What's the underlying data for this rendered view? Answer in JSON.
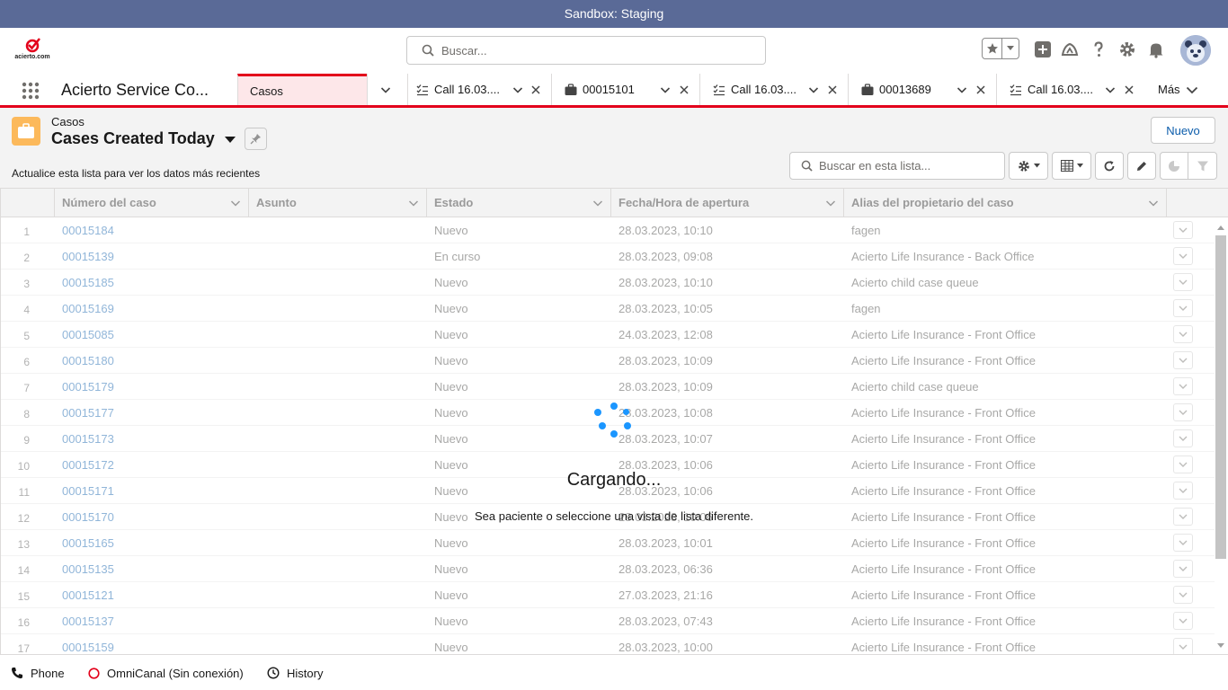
{
  "sandbox_banner": "Sandbox: Staging",
  "header": {
    "logo_text": "acierto.com",
    "search_placeholder": "Buscar..."
  },
  "nav": {
    "app_name": "Acierto Service Co...",
    "tabs": [
      {
        "label": "Casos",
        "icon": "none",
        "active": true
      },
      {
        "label": "Call 16.03....",
        "icon": "task-list-icon"
      },
      {
        "label": "00015101",
        "icon": "case-briefcase-icon"
      },
      {
        "label": "Call 16.03....",
        "icon": "task-list-icon"
      },
      {
        "label": "00013689",
        "icon": "case-briefcase-icon"
      },
      {
        "label": "Call 16.03....",
        "icon": "task-list-icon"
      }
    ],
    "more_label": "Más"
  },
  "list_view": {
    "object_label": "Casos",
    "view_name": "Cases Created Today",
    "info_text": "Actualice esta lista para ver los datos más recientes",
    "new_button": "Nuevo",
    "search_placeholder": "Buscar en esta lista..."
  },
  "table": {
    "columns": [
      "Número del caso",
      "Asunto",
      "Estado",
      "Fecha/Hora de apertura",
      "Alias del propietario del caso"
    ],
    "rows": [
      {
        "n": "1",
        "case": "00015184",
        "estado": "Nuevo",
        "fecha": "28.03.2023, 10:10",
        "alias": "fagen"
      },
      {
        "n": "2",
        "case": "00015139",
        "estado": "En curso",
        "fecha": "28.03.2023, 09:08",
        "alias": "Acierto Life Insurance - Back Office"
      },
      {
        "n": "3",
        "case": "00015185",
        "estado": "Nuevo",
        "fecha": "28.03.2023, 10:10",
        "alias": "Acierto child case queue"
      },
      {
        "n": "4",
        "case": "00015169",
        "estado": "Nuevo",
        "fecha": "28.03.2023, 10:05",
        "alias": "fagen"
      },
      {
        "n": "5",
        "case": "00015085",
        "estado": "Nuevo",
        "fecha": "24.03.2023, 12:08",
        "alias": "Acierto Life Insurance - Front Office"
      },
      {
        "n": "6",
        "case": "00015180",
        "estado": "Nuevo",
        "fecha": "28.03.2023, 10:09",
        "alias": "Acierto Life Insurance - Front Office"
      },
      {
        "n": "7",
        "case": "00015179",
        "estado": "Nuevo",
        "fecha": "28.03.2023, 10:09",
        "alias": "Acierto child case queue"
      },
      {
        "n": "8",
        "case": "00015177",
        "estado": "Nuevo",
        "fecha": "28.03.2023, 10:08",
        "alias": "Acierto Life Insurance - Front Office"
      },
      {
        "n": "9",
        "case": "00015173",
        "estado": "Nuevo",
        "fecha": "28.03.2023, 10:07",
        "alias": "Acierto Life Insurance - Front Office"
      },
      {
        "n": "10",
        "case": "00015172",
        "estado": "Nuevo",
        "fecha": "28.03.2023, 10:06",
        "alias": "Acierto Life Insurance - Front Office"
      },
      {
        "n": "11",
        "case": "00015171",
        "estado": "Nuevo",
        "fecha": "28.03.2023, 10:06",
        "alias": "Acierto Life Insurance - Front Office"
      },
      {
        "n": "12",
        "case": "00015170",
        "estado": "Nuevo",
        "fecha": "28.03.2023, 10:06",
        "alias": "Acierto Life Insurance - Front Office"
      },
      {
        "n": "13",
        "case": "00015165",
        "estado": "Nuevo",
        "fecha": "28.03.2023, 10:01",
        "alias": "Acierto Life Insurance - Front Office"
      },
      {
        "n": "14",
        "case": "00015135",
        "estado": "Nuevo",
        "fecha": "28.03.2023, 06:36",
        "alias": "Acierto Life Insurance - Front Office"
      },
      {
        "n": "15",
        "case": "00015121",
        "estado": "Nuevo",
        "fecha": "27.03.2023, 21:16",
        "alias": "Acierto Life Insurance - Front Office"
      },
      {
        "n": "16",
        "case": "00015137",
        "estado": "Nuevo",
        "fecha": "28.03.2023, 07:43",
        "alias": "Acierto Life Insurance - Front Office"
      },
      {
        "n": "17",
        "case": "00015159",
        "estado": "Nuevo",
        "fecha": "28.03.2023, 10:00",
        "alias": "Acierto Life Insurance - Front Office"
      }
    ]
  },
  "loading": {
    "title": "Cargando...",
    "subtitle": "Sea paciente o seleccione una vista de lista diferente."
  },
  "utility_bar": {
    "items": [
      {
        "label": "Phone",
        "icon": "phone-icon"
      },
      {
        "label": "OmniCanal (Sin conexión)",
        "icon": "offline-status-icon"
      },
      {
        "label": "History",
        "icon": "clock-icon"
      }
    ]
  },
  "colors": {
    "brand_red": "#e3001b",
    "sandbox_bar": "#5a6a97",
    "link_blue": "#0b5cab",
    "spinner_blue": "#1b96ff",
    "case_icon": "#fcb95b"
  }
}
